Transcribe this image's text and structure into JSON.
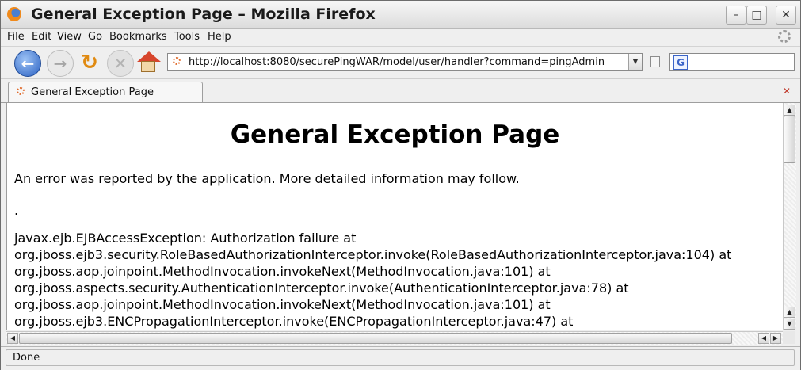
{
  "window": {
    "title": "General Exception Page – Mozilla Firefox",
    "minimize_glyph": "–",
    "maximize_glyph": "□",
    "close_glyph": "✕"
  },
  "menubar": {
    "items": [
      "File",
      "Edit",
      "View",
      "Go",
      "Bookmarks",
      "Tools",
      "Help"
    ]
  },
  "navbar": {
    "back_glyph": "←",
    "forward_glyph": "→",
    "reload_glyph": "↻",
    "stop_glyph": "✕",
    "url": "http://localhost:8080/securePingWAR/model/user/handler?command=pingAdmin",
    "url_drop_glyph": "▼",
    "search_engine_glyph": "G",
    "search_value": ""
  },
  "tabs": [
    {
      "label": "General Exception Page",
      "active": true
    }
  ],
  "page": {
    "heading": "General Exception Page",
    "intro": "An error was reported by the application. More detailed information may follow.",
    "separator": ".",
    "trace": [
      "javax.ejb.EJBAccessException: Authorization failure at",
      "org.jboss.ejb3.security.RoleBasedAuthorizationInterceptor.invoke(RoleBasedAuthorizationInterceptor.java:104) at",
      "org.jboss.aop.joinpoint.MethodInvocation.invokeNext(MethodInvocation.java:101) at",
      "org.jboss.aspects.security.AuthenticationInterceptor.invoke(AuthenticationInterceptor.java:78) at",
      "org.jboss.aop.joinpoint.MethodInvocation.invokeNext(MethodInvocation.java:101) at",
      "org.jboss.ejb3.ENCPropagationInterceptor.invoke(ENCPropagationInterceptor.java:47) at"
    ]
  },
  "scrollbars": {
    "up_glyph": "▲",
    "down_glyph": "▼",
    "left_glyph": "◀",
    "right_glyph": "▶"
  },
  "status": {
    "text": "Done"
  },
  "colors": {
    "back_button": "#2b61c2",
    "reload_icon": "#e08a11",
    "home_roof": "#d7452c"
  }
}
